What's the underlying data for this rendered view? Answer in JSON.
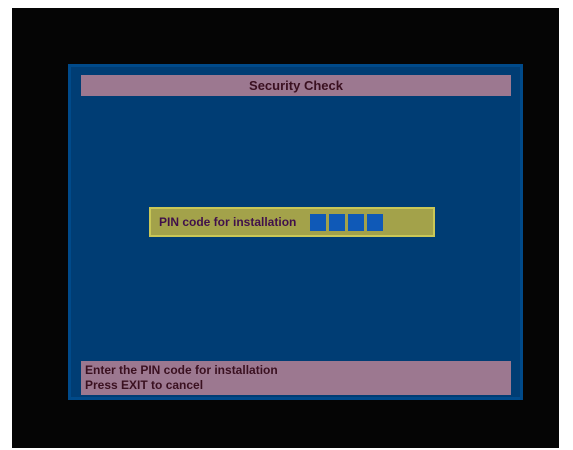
{
  "dialog": {
    "title": "Security Check"
  },
  "pin_entry": {
    "label": "PIN code for installation",
    "digit_count": 4,
    "digits_entered": 0
  },
  "help": {
    "line1": "Enter the PIN code for installation",
    "line2": "Press EXIT to cancel"
  },
  "colors": {
    "panel": "#003d74",
    "title_bar": "#9c7890",
    "pin_box": "#a3a24a",
    "pin_slot": "#0f59b7"
  }
}
